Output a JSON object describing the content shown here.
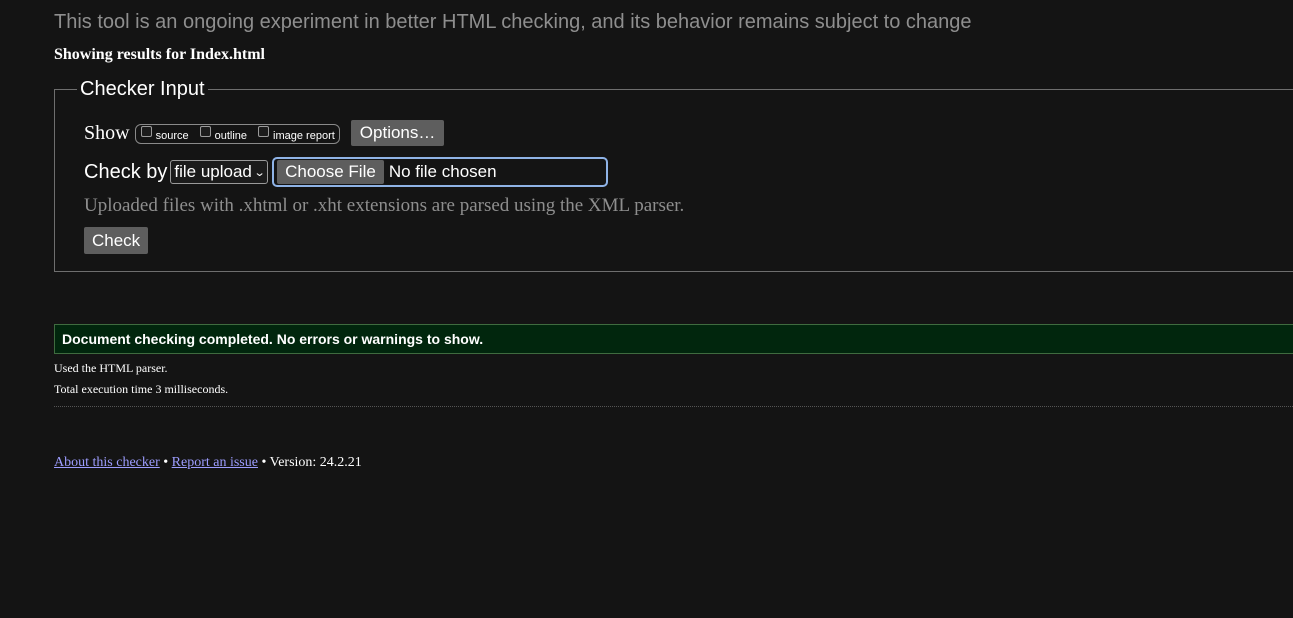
{
  "notice": "This tool is an ongoing experiment in better HTML checking, and its behavior remains subject to change",
  "results_heading": "Showing results for Index.html",
  "checker_input": {
    "legend": "Checker Input",
    "show": {
      "label": "Show",
      "options": [
        {
          "label": "source",
          "checked": false
        },
        {
          "label": "outline",
          "checked": false
        },
        {
          "label": "image report",
          "checked": false
        }
      ],
      "options_button": "Options…"
    },
    "check_by": {
      "label": "Check by",
      "selected": "file upload",
      "choose_file_button": "Choose File",
      "file_status": "No file chosen"
    },
    "hint": "Uploaded files with .xhtml or .xht extensions are parsed using the XML parser.",
    "check_button": "Check"
  },
  "result": {
    "message": "Document checking completed. No errors or warnings to show.",
    "parser_info": "Used the HTML parser.",
    "execution_time": "Total execution time 3 milliseconds."
  },
  "footer": {
    "about_link": "About this checker",
    "separator": "•",
    "report_link": "Report an issue",
    "version": "Version: 24.2.21"
  },
  "colors": {
    "background": "#141414",
    "success_banner": "#01260d",
    "link": "#9d9dff",
    "focus_ring": "#8fb3e6",
    "muted_text": "#8e8e8e"
  }
}
